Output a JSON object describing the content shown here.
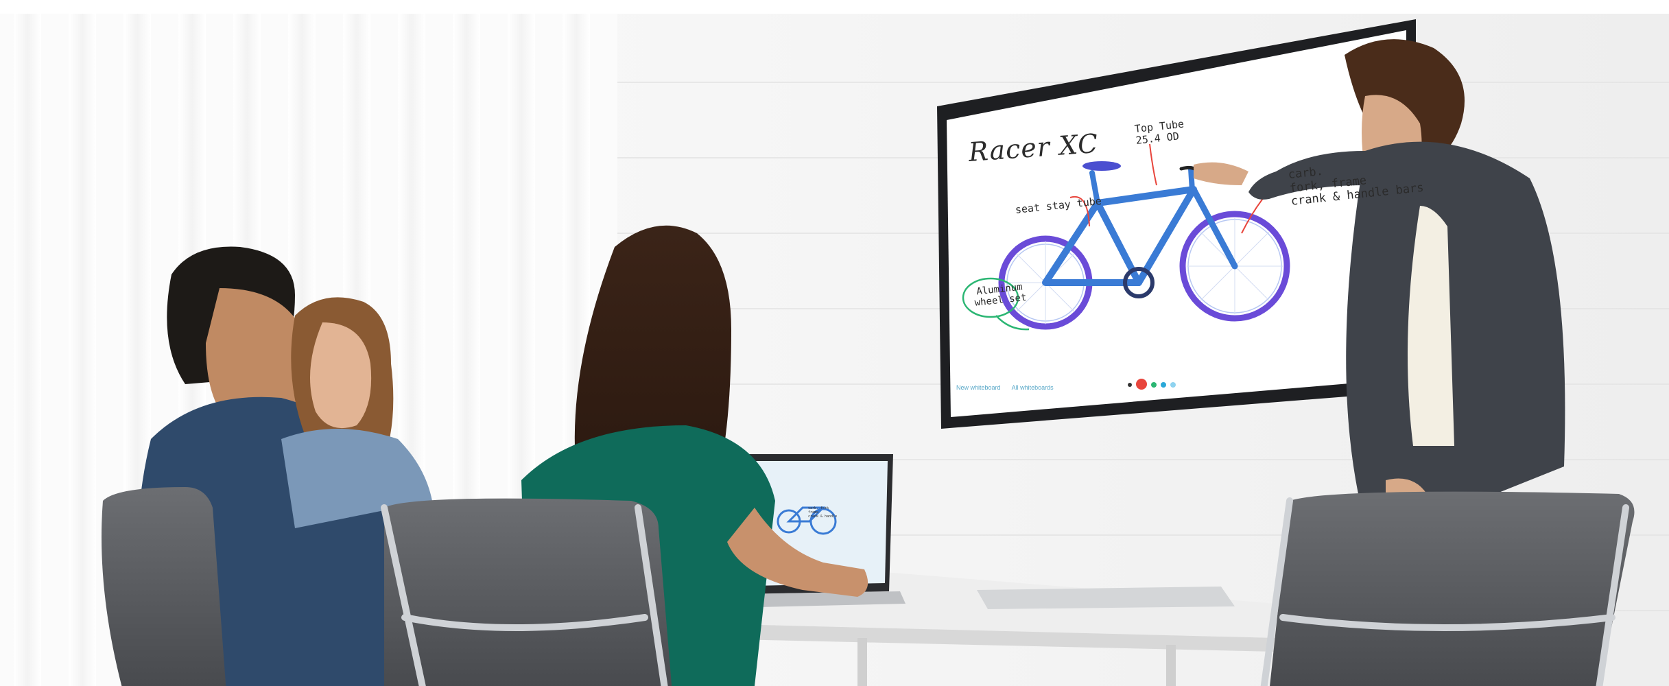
{
  "scene": {
    "description_alt": "",
    "whiteboard": {
      "title": "Racer XC",
      "annotations": {
        "top_tube": [
          "Top Tube",
          "25.4 OD"
        ],
        "seat_stay": "seat stay tube",
        "aluminum": [
          "Aluminum",
          "wheel set"
        ],
        "right": [
          "carb.",
          "fork, frame",
          "crank & handle bars"
        ]
      },
      "footer": {
        "new_whiteboard": "New whiteboard",
        "all_whiteboards": "All whiteboards"
      },
      "dot_colors": [
        "#333333",
        "#e8453c",
        "#2bb673",
        "#2aa8d8",
        "#8fd3f0"
      ]
    },
    "laptop_screen": {
      "note": [
        "carb. fork",
        "frame",
        "crank & handle"
      ]
    },
    "colors": {
      "bike": "#3a7bd5",
      "wheel_rim": "#6a4bd8",
      "shirt_green": "#0f6b5a",
      "shirt_denim": "#2f4a6b",
      "chair": "#5a5c60",
      "wall": "#f4f4f4"
    }
  }
}
